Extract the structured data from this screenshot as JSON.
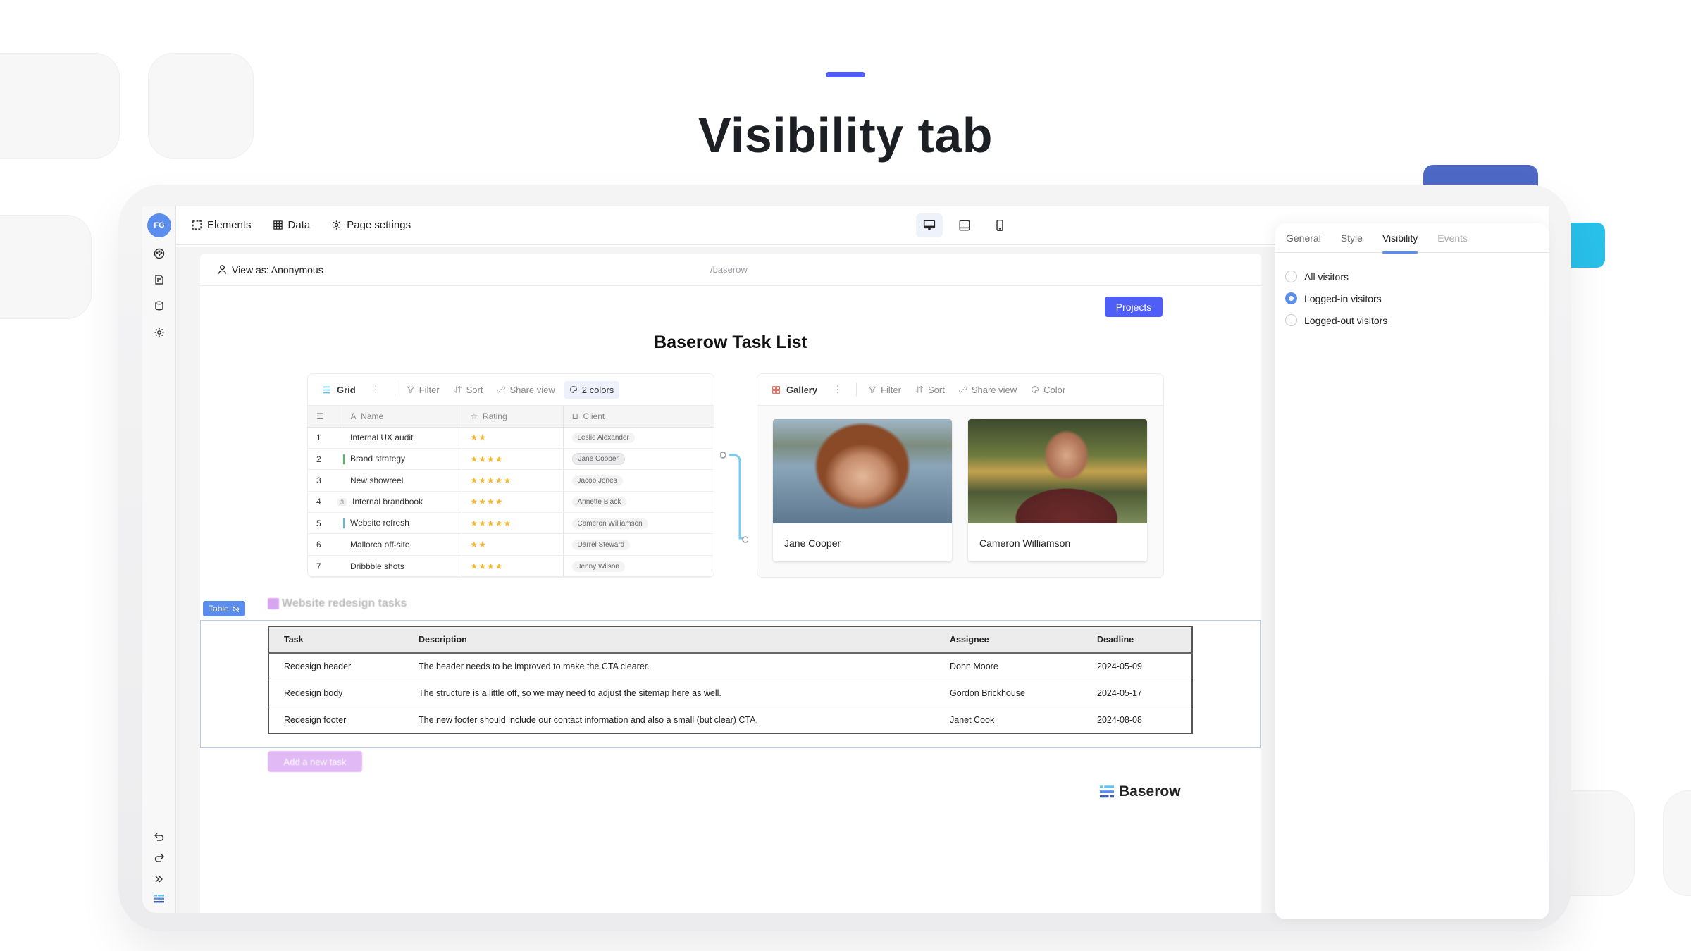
{
  "hero": {
    "title": "Visibility tab",
    "accent_color": "#4f5ef7"
  },
  "rail": {
    "avatar_initials": "FG",
    "top_icons": [
      "dashboard-icon",
      "page-edit-icon",
      "database-icon",
      "settings-icon"
    ],
    "bottom_icons": [
      "undo-icon",
      "redo-icon",
      "expand-icon",
      "baserow-logo-icon"
    ]
  },
  "topbar": {
    "elements_label": "Elements",
    "data_label": "Data",
    "page_settings_label": "Page settings",
    "devices": [
      "desktop",
      "tablet",
      "mobile"
    ],
    "active_device": "desktop"
  },
  "page": {
    "view_as_label": "View as: Anonymous",
    "path": "/baserow",
    "projects_button": "Projects",
    "title": "Baserow Task List"
  },
  "grid_mock": {
    "view_name": "Grid",
    "tools": [
      "Filter",
      "Sort",
      "Share view"
    ],
    "color_tool": "2 colors",
    "columns": [
      "Name",
      "Rating",
      "Client"
    ],
    "rows": [
      {
        "n": "1",
        "name": "Internal UX audit",
        "stars": "★★",
        "client": "Leslie Alexander"
      },
      {
        "n": "2",
        "name": "Brand strategy",
        "stars": "★★★★",
        "client": "Jane Cooper"
      },
      {
        "n": "3",
        "name": "New showreel",
        "stars": "★★★★★",
        "client": "Jacob Jones"
      },
      {
        "n": "4",
        "name": "Internal brandbook",
        "stars": "★★★★",
        "client": "Annette Black",
        "count": "3"
      },
      {
        "n": "5",
        "name": "Website refresh",
        "stars": "★★★★★",
        "client": "Cameron Williamson"
      },
      {
        "n": "6",
        "name": "Mallorca off-site",
        "stars": "★★",
        "client": "Darrel Steward"
      },
      {
        "n": "7",
        "name": "Dribbble shots",
        "stars": "★★★★",
        "client": "Jenny Wilson"
      }
    ]
  },
  "gallery_mock": {
    "view_name": "Gallery",
    "tools": [
      "Filter",
      "Sort",
      "Share view",
      "Color"
    ],
    "cards": [
      "Jane Cooper",
      "Cameron Williamson"
    ]
  },
  "table_element": {
    "badge": "Table",
    "heading": "Website redesign tasks",
    "columns": [
      "Task",
      "Description",
      "Assignee",
      "Deadline"
    ],
    "rows": [
      [
        "Redesign header",
        "The header needs to be improved to make the CTA clearer.",
        "Donn Moore",
        "2024-05-09"
      ],
      [
        "Redesign body",
        "The structure is a little off, so we may need to adjust the sitemap here as well.",
        "Gordon Brickhouse",
        "2024-05-17"
      ],
      [
        "Redesign footer",
        "The new footer should include our contact information and also a small (but clear) CTA.",
        "Janet Cook",
        "2024-08-08"
      ]
    ],
    "add_button": "Add a new task"
  },
  "footer_logo": "Baserow",
  "panel": {
    "tabs": [
      "General",
      "Style",
      "Visibility",
      "Events"
    ],
    "active_tab": "Visibility",
    "options": [
      "All visitors",
      "Logged-in visitors",
      "Logged-out visitors"
    ],
    "selected_option": "Logged-in visitors"
  }
}
